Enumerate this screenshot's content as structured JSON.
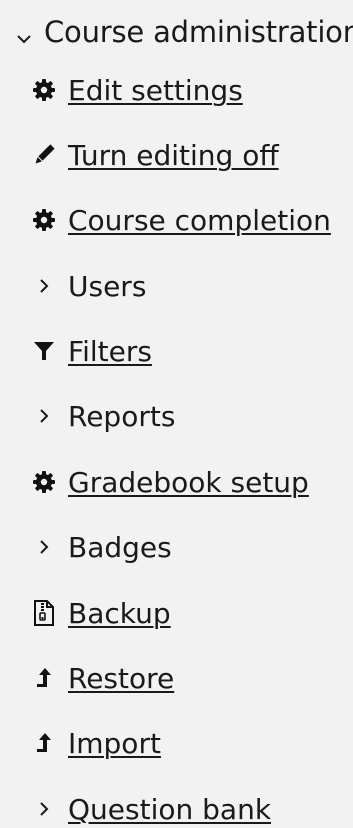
{
  "nav": {
    "header": "Course administration",
    "items": [
      {
        "label": "Edit settings",
        "icon": "gear-icon",
        "type": "link"
      },
      {
        "label": "Turn editing off",
        "icon": "pencil-icon",
        "type": "link"
      },
      {
        "label": "Course completion",
        "icon": "gear-icon",
        "type": "link"
      },
      {
        "label": "Users",
        "icon": "chevron-right-icon",
        "type": "expandable"
      },
      {
        "label": "Filters",
        "icon": "filter-icon",
        "type": "link"
      },
      {
        "label": "Reports",
        "icon": "chevron-right-icon",
        "type": "expandable"
      },
      {
        "label": "Gradebook setup",
        "icon": "gear-icon",
        "type": "link"
      },
      {
        "label": "Badges",
        "icon": "chevron-right-icon",
        "type": "expandable"
      },
      {
        "label": "Backup",
        "icon": "archive-file-icon",
        "type": "link"
      },
      {
        "label": "Restore",
        "icon": "level-up-arrow-icon",
        "type": "link"
      },
      {
        "label": "Import",
        "icon": "level-up-arrow-icon",
        "type": "link"
      },
      {
        "label": "Question bank",
        "icon": "chevron-right-icon",
        "type": "expandable-link"
      }
    ]
  }
}
